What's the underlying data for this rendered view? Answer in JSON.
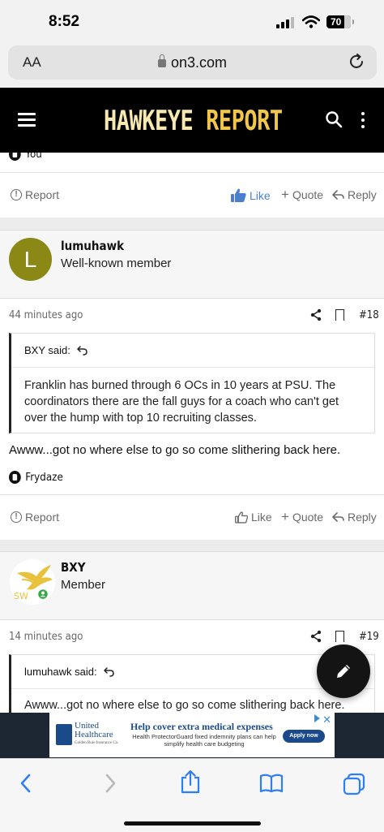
{
  "status_bar": {
    "time": "8:52",
    "battery": "70"
  },
  "browser": {
    "aa_label": "AA",
    "url": "on3.com"
  },
  "site": {
    "logo_left": "HAWKEYE",
    "logo_right": "REPORT"
  },
  "post_top": {
    "reaction_user": "You",
    "actions": {
      "report": "Report",
      "like": "Like",
      "quote": "Quote",
      "reply": "Reply"
    }
  },
  "post_18": {
    "author": {
      "avatar_letter": "L",
      "username": "lumuhawk",
      "title": "Well-known member",
      "avatar_color": "#8b8816"
    },
    "time": "44 minutes ago",
    "number": "#18",
    "quote": {
      "author_said": "BXY said:",
      "text": "Franklin has burned through 6 OCs in 10 years at PSU. The coordinators there are the fall guys for a coach who can't get over the hump with top 10 recruiting classes."
    },
    "body": "Awww...got no where else to go so come slithering back here.",
    "reaction_user": "Frydaze",
    "actions": {
      "report": "Report",
      "like": "Like",
      "quote": "Quote",
      "reply": "Reply"
    }
  },
  "post_19": {
    "author": {
      "username": "BXY",
      "title": "Member",
      "avatar_caption": "SW"
    },
    "time": "14 minutes ago",
    "number": "#19",
    "quote": {
      "author_said": "lumuhawk said:",
      "text": "Awww...got no where else to go so come slithering back here."
    }
  },
  "ad": {
    "brand_line1": "United",
    "brand_line2": "Healthcare",
    "brand_small": "Golden Rule Insurance Co.",
    "headline": "Help cover extra medical expenses",
    "subtext": "Health ProtectorGuard fixed indemnity plans can help simplify health care budgeting",
    "cta": "Apply now"
  },
  "colors": {
    "accent_like": "#4a7fd0",
    "header_bg": "#000000",
    "logo_gold": "#f0c64b"
  }
}
